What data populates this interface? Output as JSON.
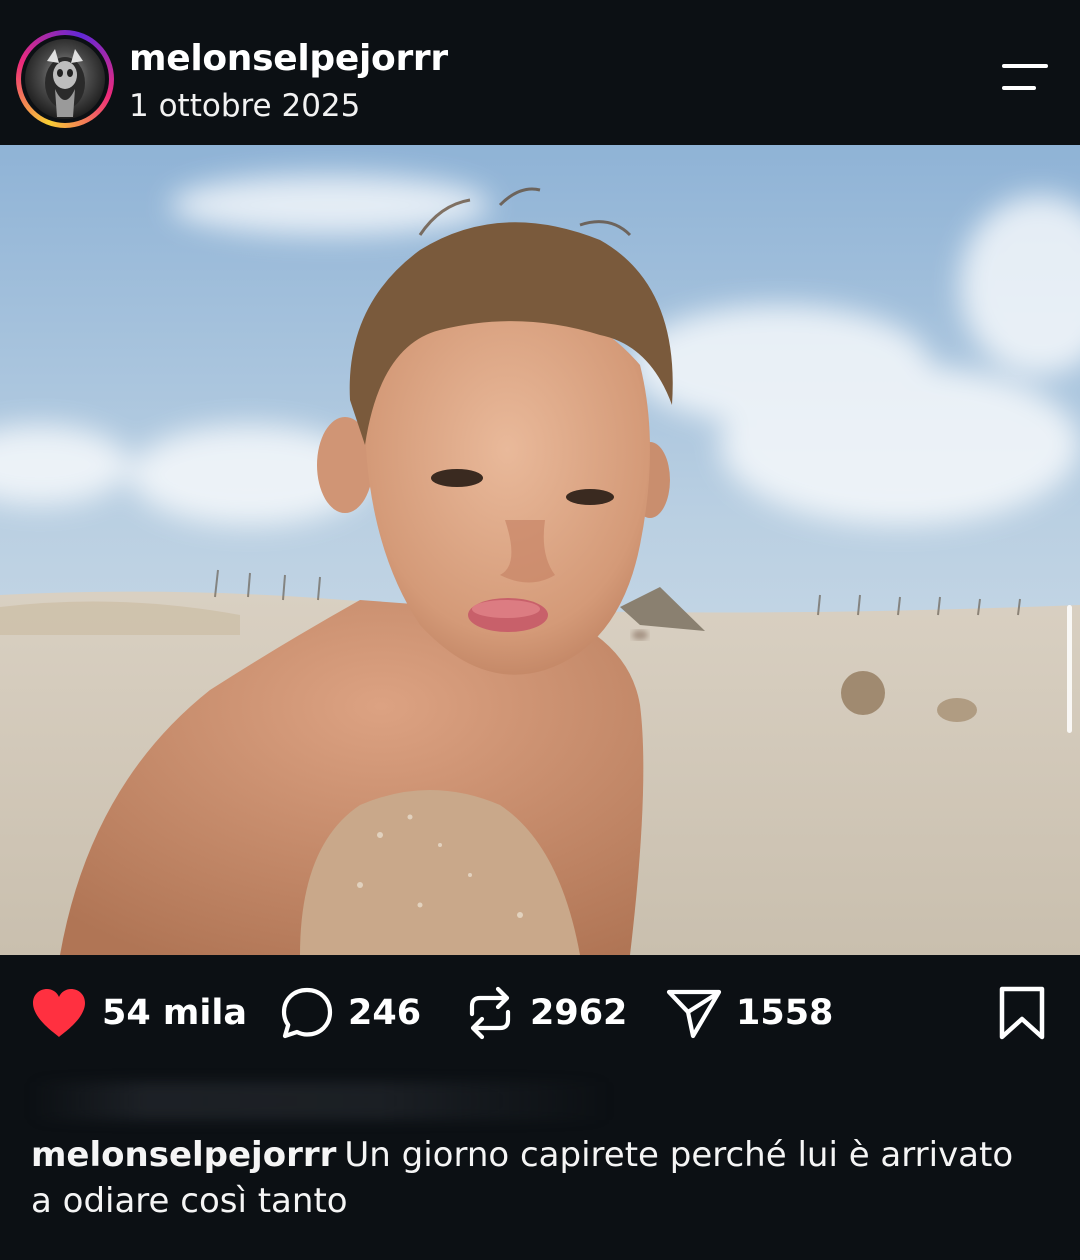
{
  "post": {
    "username": "melonselpejorrr",
    "date": "1 ottobre 2025"
  },
  "actions": {
    "likes": "54 mila",
    "comments": "246",
    "reposts": "2962",
    "shares": "1558"
  },
  "caption": {
    "username": "melonselpejorrr",
    "text": "Un giorno capirete perché lui è arrivato a odiare così tanto"
  },
  "icons": {
    "menu": "menu-icon",
    "like": "heart-icon",
    "comment": "comment-bubble-icon",
    "repost": "repost-icon",
    "share": "send-icon",
    "save": "bookmark-icon"
  },
  "colors": {
    "background": "#0c1014",
    "like_red": "#ff3040",
    "text": "#ffffff"
  }
}
